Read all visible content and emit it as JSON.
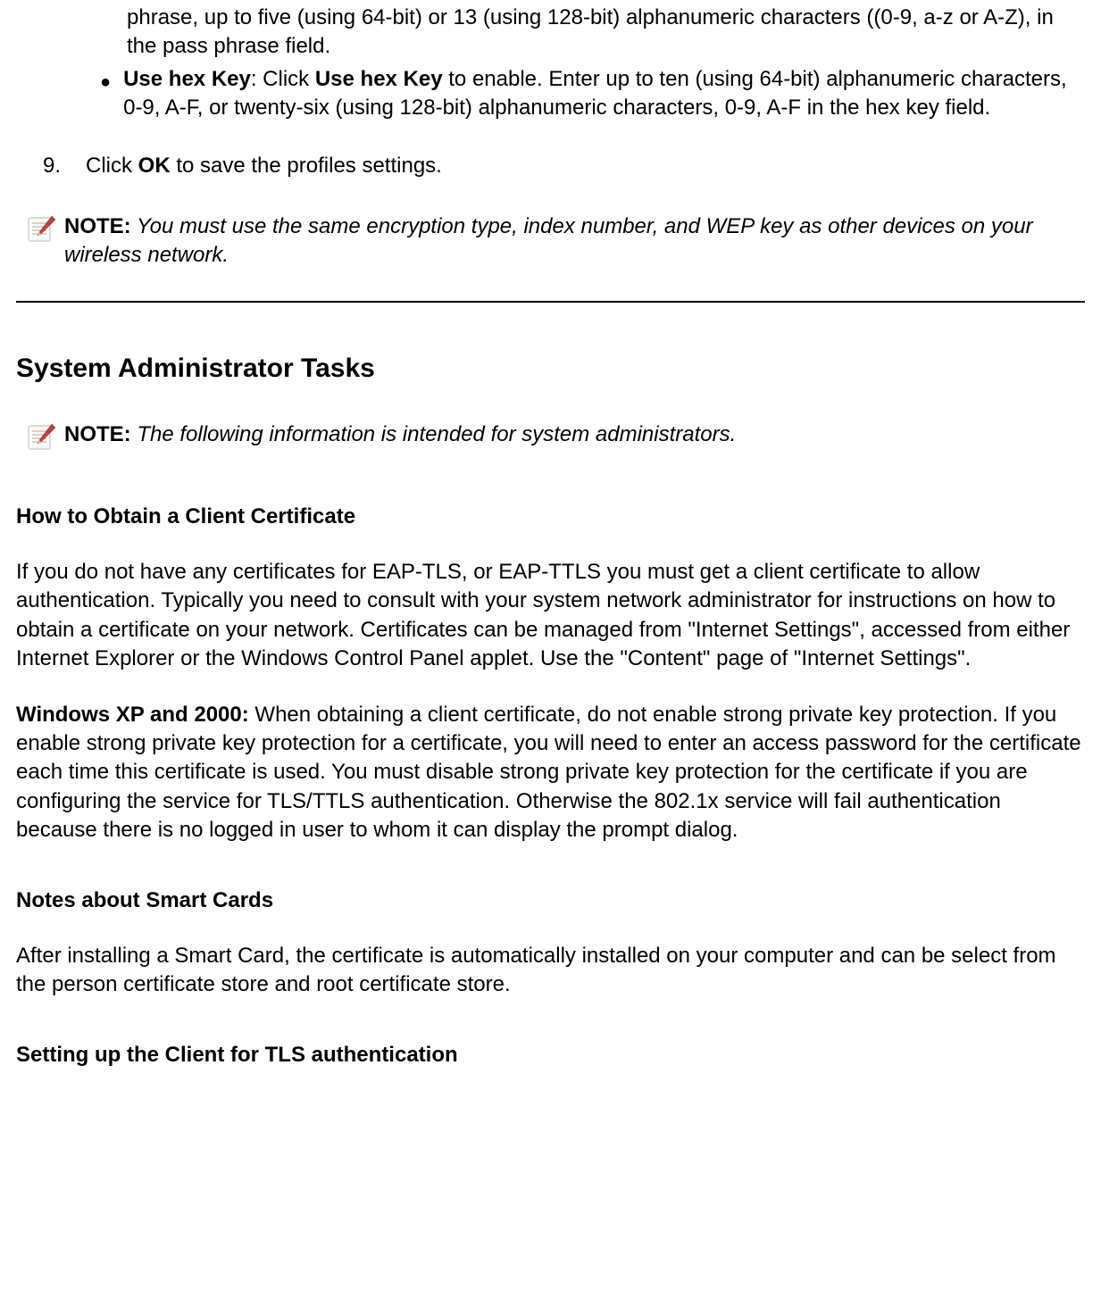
{
  "prevBulletCont": "phrase, up to five (using 64-bit) or 13 (using 128-bit) alphanumeric characters ((0-9, a-z or A-Z), in the pass phrase field.",
  "hexKey": {
    "boldLabel": "Use hex Key",
    "afterLabel": ": Click ",
    "boldLabel2": "Use hex Key",
    "afterLabel2": " to enable. Enter up to ten (using 64-bit) alphanumeric characters, 0-9, A-F, or twenty-six (using 128-bit) alphanumeric characters, 0-9, A-F in the hex key field."
  },
  "step9": {
    "number": "9.",
    "prefix": "Click ",
    "bold": "OK",
    "suffix": " to save the profiles settings."
  },
  "note1": {
    "label": "NOTE:",
    "text": " You must use the same encryption type, index number, and WEP key as other devices on your wireless network."
  },
  "heading": "System Administrator Tasks",
  "note2": {
    "label": "NOTE:",
    "text": " The following information is intended for system administrators."
  },
  "subheading1": "How to Obtain a Client Certificate",
  "para1": "If you do not have any certificates for EAP-TLS, or EAP-TTLS you must get a client certificate to allow authentication. Typically you need to consult with your system network administrator for instructions on how to obtain a certificate on your network. Certificates can be managed from \"Internet Settings\", accessed from either Internet Explorer or the Windows Control Panel applet. Use the \"Content\" page of \"Internet Settings\".",
  "para2": {
    "bold": "Windows XP and 2000:",
    "text": " When obtaining a client certificate, do not enable strong private key protection. If you enable strong private key protection for a certificate, you will need to enter an access password for the certificate each time this certificate is used. You must disable strong private key protection for the certificate if you are configuring the service for TLS/TTLS authentication. Otherwise the 802.1x service will fail authentication because there is no logged in user to whom it can display the prompt dialog."
  },
  "subheading2": "Notes about Smart Cards",
  "para3": "After installing a Smart Card, the certificate is automatically installed on your computer and can be select from the person certificate store and root certificate store.",
  "subheading3": "Setting up the Client for TLS authentication"
}
